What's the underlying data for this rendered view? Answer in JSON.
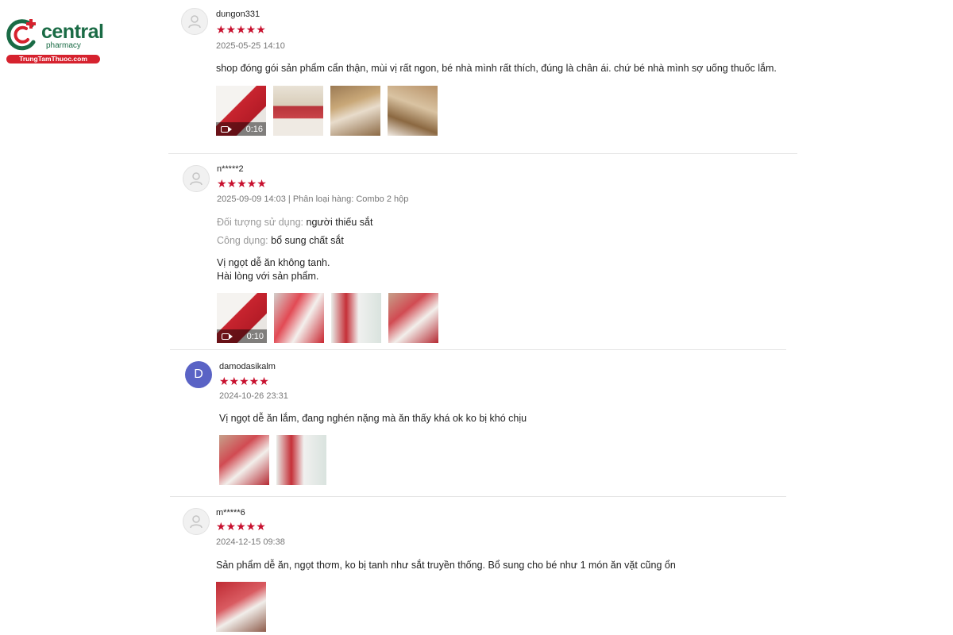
{
  "logo": {
    "brand": "central",
    "sub": "pharmacy",
    "url": "TrungTamThuoc.com",
    "colors": {
      "green": "#1a6b45",
      "red": "#d6222e"
    }
  },
  "reviews": [
    {
      "username": "dungon331",
      "avatar": "user-icon",
      "stars": "★★★★★",
      "meta": "2025-05-25 14:10",
      "comment": "shop đóng gói sản phẩm cẩn thận, mùi vị rất ngon, bé nhà mình rất thích, đúng là chân ái. chứ bé nhà mình sợ uống thuốc lắm.",
      "video_duration": "0:16"
    },
    {
      "username": "n*****2",
      "avatar": "user-icon",
      "stars": "★★★★★",
      "meta": "2025-09-09 14:03 | Phân loại hàng: Combo 2 hộp",
      "attr1_label": "Đối tượng sử dụng:",
      "attr1_value": "người thiếu sắt",
      "attr2_label": "Công dụng:",
      "attr2_value": "bổ sung chất sắt",
      "comment_line1": "Vị ngọt dễ ăn không tanh.",
      "comment_line2": "Hài lòng với sản phẩm.",
      "video_duration": "0:10"
    },
    {
      "username": "damodasikalm",
      "avatar_letter": "D",
      "stars": "★★★★★",
      "meta": "2024-10-26 23:31",
      "comment": "Vị ngọt dễ ăn lắm, đang nghén nặng mà ăn thấy khá ok ko bị khó chịu"
    },
    {
      "username": "m*****6",
      "avatar": "user-icon",
      "stars": "★★★★★",
      "meta": "2024-12-15 09:38",
      "comment": "Sản phẩm dễ ăn, ngọt thơm, ko bị tanh như sắt truyền thống. Bổ sung cho bé như 1 món ăn vặt cũng ổn"
    }
  ],
  "colors": {
    "star": "#c8102e",
    "avatar_letter_bg": "#5a63c5"
  }
}
